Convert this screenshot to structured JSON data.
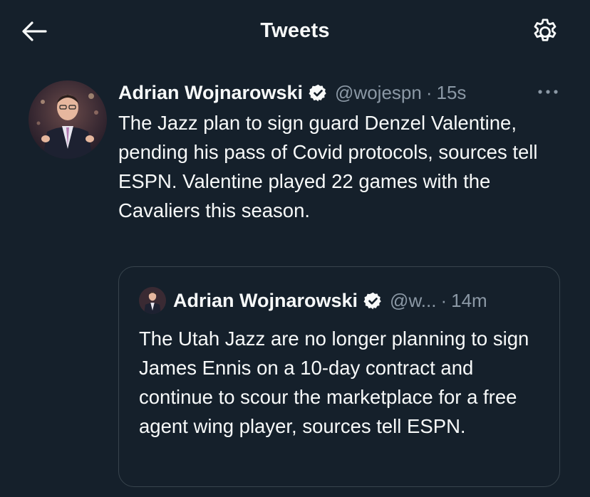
{
  "header": {
    "title": "Tweets",
    "back_icon": "arrow-left-icon",
    "settings_icon": "gear-icon"
  },
  "tweet": {
    "author_name": "Adrian Wojnarowski",
    "handle": "@wojespn",
    "separator": "·",
    "time": "15s",
    "more_label": "···",
    "verified_icon": "verified-badge-icon",
    "text": "The Jazz plan to sign guard Denzel Valentine, pending his pass of Covid protocols, sources tell ESPN. Valentine played 22 games with the Cavaliers this season."
  },
  "quoted_tweet": {
    "author_name": "Adrian Wojnarowski",
    "handle": "@w...",
    "separator": "·",
    "time": "14m",
    "verified_icon": "verified-badge-icon",
    "text": "The Utah Jazz are no longer planning to sign James Ennis on a 10-day contract and continue to scour the marketplace for a free agent wing player, sources tell ESPN."
  },
  "colors": {
    "background": "#15202b",
    "text_primary": "#f7f9f9",
    "text_secondary": "#8b98a5",
    "border": "#38444d"
  }
}
